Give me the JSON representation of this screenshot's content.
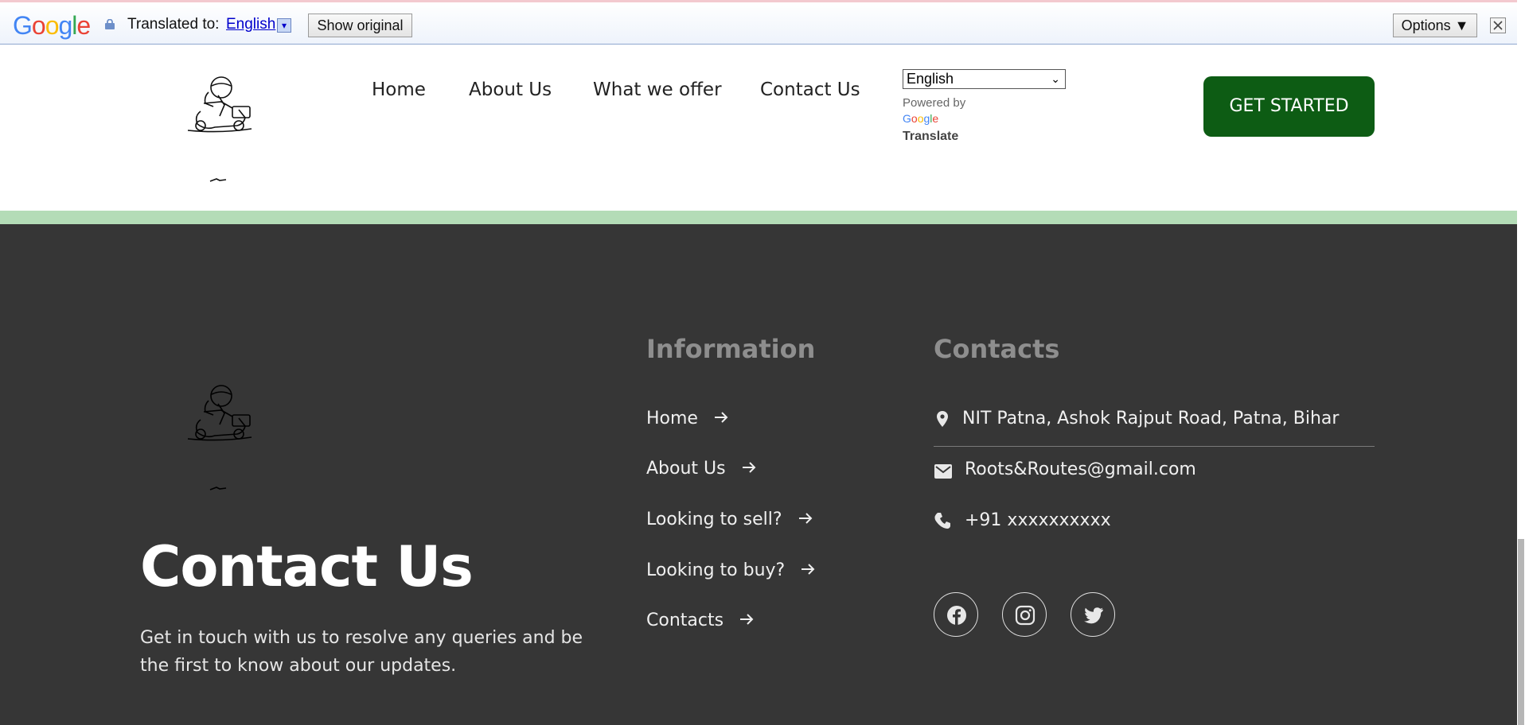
{
  "translate_bar": {
    "logo_letters": [
      {
        "ch": "G",
        "color": "#4285F4"
      },
      {
        "ch": "o",
        "color": "#EA4335"
      },
      {
        "ch": "o",
        "color": "#FBBC05"
      },
      {
        "ch": "g",
        "color": "#4285F4"
      },
      {
        "ch": "l",
        "color": "#34A853"
      },
      {
        "ch": "e",
        "color": "#EA4335"
      }
    ],
    "translated_to_label": "Translated to:",
    "language": "English",
    "show_original_label": "Show original",
    "options_label": "Options ▼"
  },
  "header": {
    "nav": [
      "Home",
      "About Us",
      "What we offer",
      "Contact Us"
    ],
    "language_select": "English",
    "powered_by": "Powered by",
    "google_small": [
      {
        "ch": "G",
        "color": "#4285F4"
      },
      {
        "ch": "o",
        "color": "#EA4335"
      },
      {
        "ch": "o",
        "color": "#FBBC05"
      },
      {
        "ch": "g",
        "color": "#4285F4"
      },
      {
        "ch": "l",
        "color": "#34A853"
      },
      {
        "ch": "e",
        "color": "#EA4335"
      }
    ],
    "translate_label": "Translate",
    "cta_label": "GET STARTED",
    "cta_color": "#0d5c14"
  },
  "footer": {
    "title": "Contact Us",
    "description": "Get in touch with us to resolve any queries and be the first to know about our updates.",
    "information_heading": "Information",
    "information_links": [
      "Home",
      "About Us",
      "Looking to sell?",
      "Looking to buy?",
      "Contacts"
    ],
    "contacts_heading": "Contacts",
    "address": "NIT Patna, Ashok Rajput Road, Patna, Bihar",
    "email": "Roots&Routes@gmail.com",
    "phone": "+91 xxxxxxxxxx",
    "social_icons": [
      "facebook-icon",
      "instagram-icon",
      "twitter-icon"
    ]
  },
  "colors": {
    "footer_bg": "#363636",
    "accent_strip": "#b4dcb7"
  }
}
